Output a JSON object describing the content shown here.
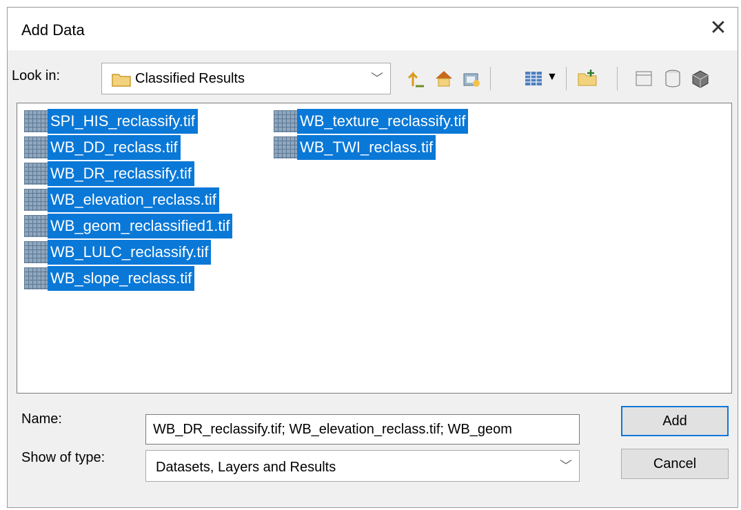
{
  "dialog": {
    "title": "Add Data"
  },
  "look_in": {
    "label": "Look in:",
    "value": "Classified Results"
  },
  "toolbar": {
    "icons": [
      "up-one-level-icon",
      "home-icon",
      "connect-folder-icon",
      "view-options-icon",
      "new-folder-icon",
      "catalog-icon",
      "database-icon",
      "toolbox-icon"
    ]
  },
  "files": {
    "column1": [
      "SPI_HIS_reclassify.tif",
      "WB_DD_reclass.tif",
      "WB_DR_reclassify.tif",
      "WB_elevation_reclass.tif",
      "WB_geom_reclassified1.tif",
      "WB_LULC_reclassify.tif",
      "WB_slope_reclass.tif"
    ],
    "column2": [
      "WB_texture_reclassify.tif",
      "WB_TWI_reclass.tif"
    ]
  },
  "name": {
    "label": "Name:",
    "value": "WB_DR_reclassify.tif; WB_elevation_reclass.tif; WB_geom"
  },
  "type": {
    "label": "Show of type:",
    "value": "Datasets, Layers and Results"
  },
  "buttons": {
    "add": "Add",
    "cancel": "Cancel"
  },
  "colors": {
    "selection": "#0a78d7",
    "dialog_bg": "#f0f0f0"
  }
}
